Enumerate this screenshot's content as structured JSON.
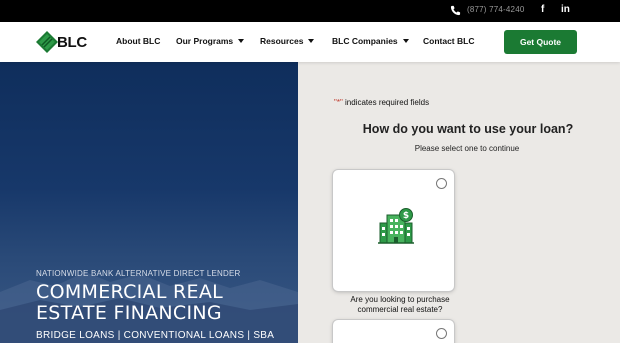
{
  "topbar": {
    "phone_icon": "phone-icon",
    "phone": "(877) 774-4240",
    "facebook_label": "f",
    "linkedin_label": "in"
  },
  "nav": {
    "logo_text": "BLC",
    "items": [
      {
        "label": "About BLC",
        "has_caret": false
      },
      {
        "label": "Our Programs",
        "has_caret": true
      },
      {
        "label": "Resources",
        "has_caret": true
      },
      {
        "label": "BLC Companies",
        "has_caret": true
      },
      {
        "label": "Contact BLC",
        "has_caret": false
      }
    ],
    "cta_label": "Get Quote"
  },
  "hero": {
    "tagline": "NATIONWIDE BANK ALTERNATIVE DIRECT LENDER",
    "heading_line1": "COMMERCIAL REAL",
    "heading_line2": "ESTATE FINANCING",
    "subheading": "BRIDGE LOANS | CONVENTIONAL LOANS | SBA"
  },
  "form": {
    "required_star": "\"*\"",
    "required_text": " indicates required fields",
    "question": "How do you want to use your loan?",
    "instruction": "Please select one to continue",
    "options": [
      {
        "icon": "building-dollar-icon",
        "label": "Are you looking to purchase commercial real estate?"
      }
    ]
  },
  "colors": {
    "brand_green": "#1b7a33",
    "hero_blue": "#0f2e5c",
    "form_bg": "#ebe9e6"
  }
}
